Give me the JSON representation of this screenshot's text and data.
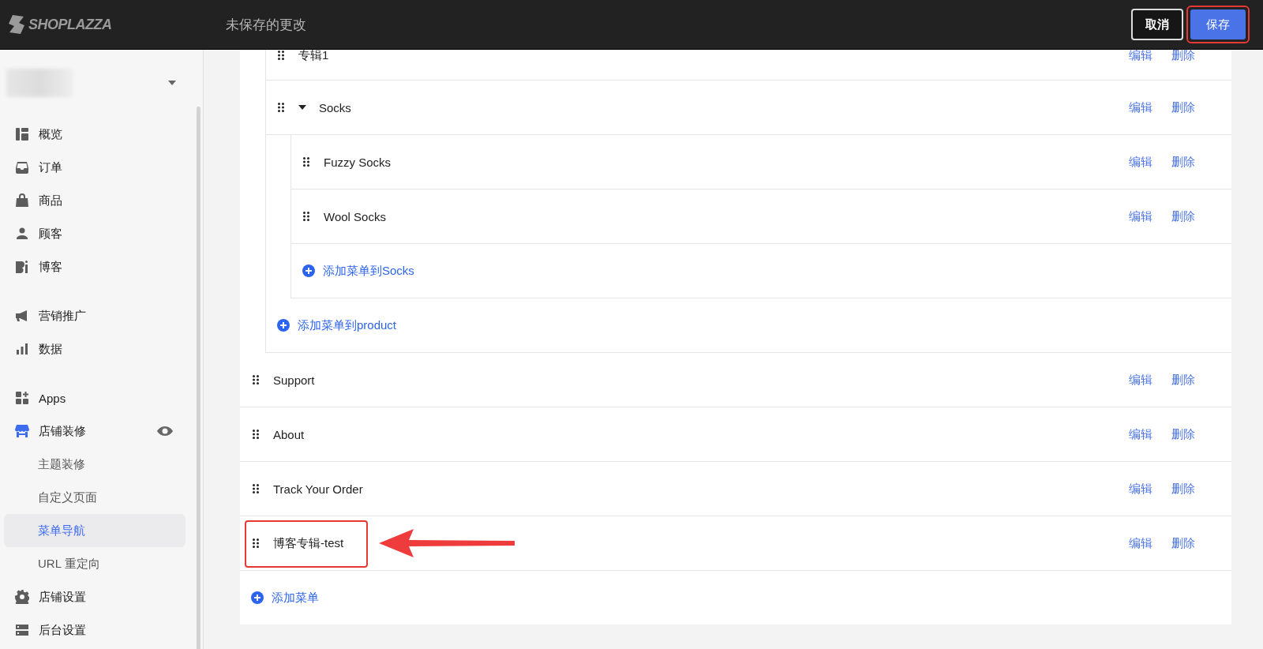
{
  "header": {
    "logo": "SHOPLAZZA",
    "title": "未保存的更改",
    "cancel": "取消",
    "save": {
      "label": "保存",
      "highlighted": true
    }
  },
  "sidebar": {
    "sections": [
      {
        "items": [
          {
            "label": "概览",
            "active": false
          },
          {
            "label": "订单",
            "active": false
          },
          {
            "label": "商品",
            "active": false
          },
          {
            "label": "顾客",
            "active": false
          },
          {
            "label": "博客",
            "active": false
          }
        ]
      },
      {
        "items": [
          {
            "label": "营销推广",
            "active": false
          },
          {
            "label": "数据",
            "active": false
          }
        ]
      },
      {
        "items": [
          {
            "label": "Apps",
            "active": false
          },
          {
            "label": "店铺装修",
            "active": true,
            "children": [
              {
                "label": "主题装修",
                "selected": false
              },
              {
                "label": "自定义页面",
                "selected": false
              },
              {
                "label": "菜单导航",
                "selected": true
              },
              {
                "label": "URL 重定向",
                "selected": false
              }
            ]
          },
          {
            "label": "店铺设置",
            "active": false
          },
          {
            "label": "后台设置",
            "active": false
          }
        ]
      }
    ]
  },
  "menu": {
    "items": [
      {
        "kind": "group",
        "children": [
          {
            "label": "专辑1",
            "actions": [
              "编辑",
              "删除"
            ]
          },
          {
            "label": "Socks",
            "expanded": true,
            "actions": [
              "编辑",
              "删除"
            ],
            "children": [
              {
                "label": "Fuzzy Socks",
                "actions": [
                  "编辑",
                  "删除"
                ]
              },
              {
                "label": "Wool Socks",
                "actions": [
                  "编辑",
                  "删除"
                ]
              }
            ],
            "add_label": "添加菜单到Socks"
          }
        ],
        "add_label": "添加菜单到product"
      },
      {
        "kind": "item",
        "label": "Support",
        "highlighted": false,
        "actions": [
          "编辑",
          "删除"
        ]
      },
      {
        "kind": "item",
        "label": "About",
        "highlighted": false,
        "actions": [
          "编辑",
          "删除"
        ]
      },
      {
        "kind": "item",
        "label": "Track Your Order",
        "highlighted": false,
        "actions": [
          "编辑",
          "删除"
        ]
      },
      {
        "kind": "item",
        "label": "博客专辑-test",
        "highlighted": true,
        "actions": [
          "编辑",
          "删除"
        ]
      }
    ],
    "add_label": "添加菜单"
  }
}
